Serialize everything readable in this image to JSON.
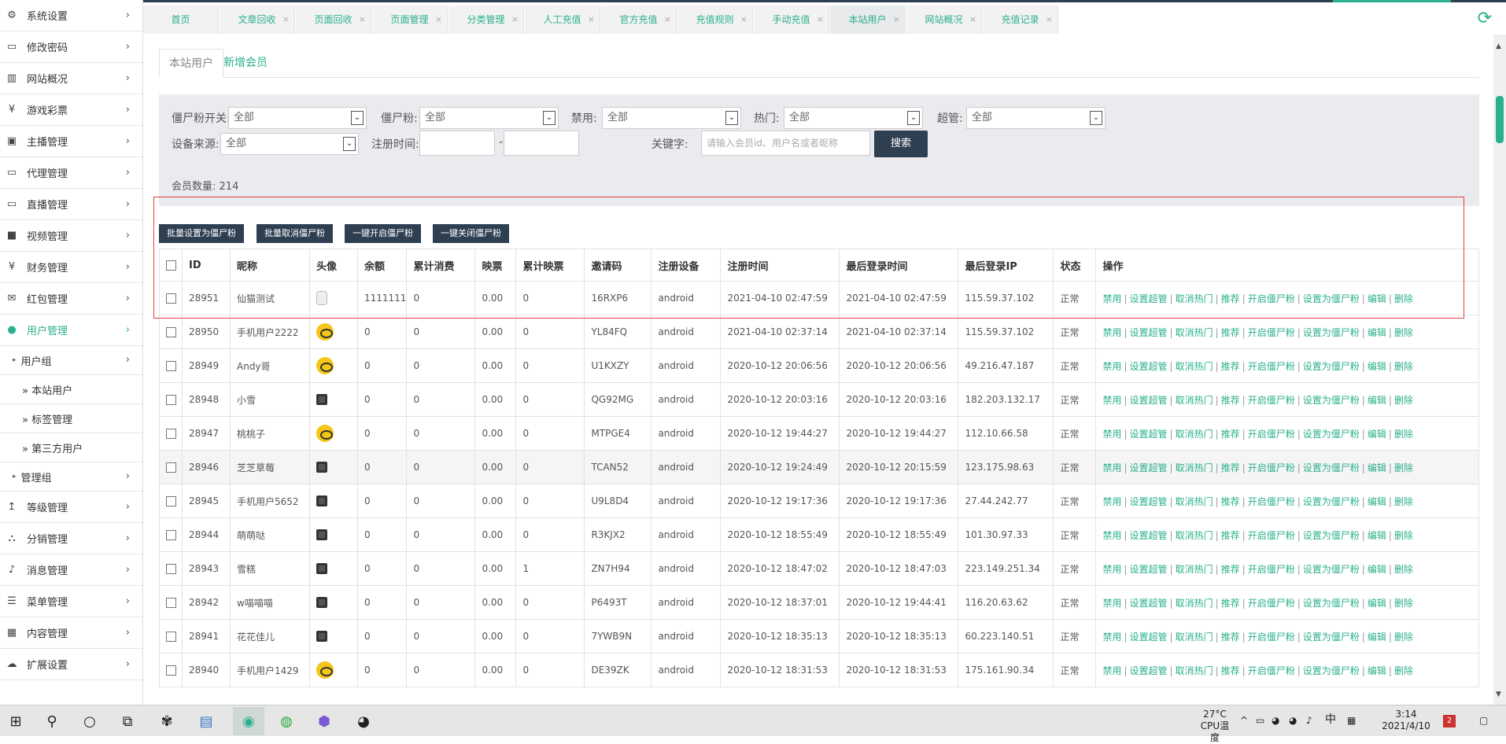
{
  "sidebar": {
    "items": [
      {
        "label": "系统设置",
        "icon": "gear-icon",
        "glyph": "⚙"
      },
      {
        "label": "修改密码",
        "icon": "monitor-icon",
        "glyph": "▭"
      },
      {
        "label": "网站概况",
        "icon": "bar-chart-icon",
        "glyph": "▥"
      },
      {
        "label": "游戏彩票",
        "icon": "yen-icon",
        "glyph": "¥"
      },
      {
        "label": "主播管理",
        "icon": "id-card-icon",
        "glyph": "▣"
      },
      {
        "label": "代理管理",
        "icon": "monitor-icon",
        "glyph": "▭"
      },
      {
        "label": "直播管理",
        "icon": "monitor-icon",
        "glyph": "▭"
      },
      {
        "label": "视频管理",
        "icon": "video-camera-icon",
        "glyph": "■"
      },
      {
        "label": "财务管理",
        "icon": "yen-icon",
        "glyph": "¥"
      },
      {
        "label": "红包管理",
        "icon": "envelope-icon",
        "glyph": "✉"
      },
      {
        "label": "用户管理",
        "icon": "users-icon",
        "glyph": "●"
      }
    ],
    "subitems": [
      {
        "label": "用户组"
      }
    ],
    "subsubitems": [
      {
        "label": "» 本站用户"
      },
      {
        "label": "» 标签管理"
      },
      {
        "label": "» 第三方用户"
      }
    ],
    "subitems2": [
      {
        "label": "管理组"
      }
    ],
    "items2": [
      {
        "label": "等级管理",
        "icon": "level-up-icon",
        "glyph": "↥"
      },
      {
        "label": "分销管理",
        "icon": "sitemap-icon",
        "glyph": "⛬"
      },
      {
        "label": "消息管理",
        "icon": "bell-icon",
        "glyph": "♪"
      },
      {
        "label": "菜单管理",
        "icon": "list-icon",
        "glyph": "☰"
      },
      {
        "label": "内容管理",
        "icon": "grid-icon",
        "glyph": "▦"
      },
      {
        "label": "扩展设置",
        "icon": "cloud-icon",
        "glyph": "☁"
      }
    ]
  },
  "tabs": [
    "首页",
    "文章回收",
    "页面回收",
    "页面管理",
    "分类管理",
    "人工充值",
    "官方充值",
    "充值规则",
    "手动充值",
    "本站用户",
    "网站概况",
    "充值记录"
  ],
  "active_tab": "本站用户",
  "subtabs": {
    "first": "本站用户",
    "second": "新增会员"
  },
  "filters": {
    "zombie_switch_label": "僵尸粉开关:",
    "zombie_label": "僵尸粉:",
    "ban_label": "禁用:",
    "hot_label": "热门:",
    "super_label": "超管:",
    "device_label": "设备来源:",
    "reg_time_label": "注册时间:",
    "keyword_label": "关键字:",
    "all": "全部",
    "dash": "-",
    "keyword_placeholder": "请输入会员id、用户名或者昵称",
    "search_button": "搜索",
    "member_count_label": "会员数量:",
    "member_count": "214"
  },
  "bulk": [
    "批量设置为僵尸粉",
    "批量取消僵尸粉",
    "一键开启僵尸粉",
    "一键关闭僵尸粉"
  ],
  "table": {
    "headers": [
      "ID",
      "昵称",
      "头像",
      "余额",
      "累计消费",
      "映票",
      "累计映票",
      "邀请码",
      "注册设备",
      "注册时间",
      "最后登录时间",
      "最后登录IP",
      "状态",
      "操作"
    ],
    "ops": [
      "禁用",
      "设置超管",
      "取消热门",
      "推荐",
      "开启僵尸粉",
      "设置为僵尸粉",
      "编辑",
      "删除"
    ],
    "rows": [
      [
        "28951",
        "仙猫测试",
        "light",
        "1111111",
        "0",
        "0.00",
        "0",
        "16RXP6",
        "android",
        "2021-04-10 02:47:59",
        "2021-04-10 02:47:59",
        "115.59.37.102",
        "正常"
      ],
      [
        "28950",
        "手机用户2222",
        "yellow",
        "0",
        "0",
        "0.00",
        "0",
        "YL84FQ",
        "android",
        "2021-04-10 02:37:14",
        "2021-04-10 02:37:14",
        "115.59.37.102",
        "正常"
      ],
      [
        "28949",
        "Andy哥",
        "yellow",
        "0",
        "0",
        "0.00",
        "0",
        "U1KXZY",
        "android",
        "2020-10-12 20:06:56",
        "2020-10-12 20:06:56",
        "49.216.47.187",
        "正常"
      ],
      [
        "28948",
        "小雪",
        "dark",
        "0",
        "0",
        "0.00",
        "0",
        "QG92MG",
        "android",
        "2020-10-12 20:03:16",
        "2020-10-12 20:03:16",
        "182.203.132.17",
        "正常"
      ],
      [
        "28947",
        "桃桃子",
        "yellow",
        "0",
        "0",
        "0.00",
        "0",
        "MTPGE4",
        "android",
        "2020-10-12 19:44:27",
        "2020-10-12 19:44:27",
        "112.10.66.58",
        "正常"
      ],
      [
        "28946",
        "芝芝草莓",
        "dark",
        "0",
        "0",
        "0.00",
        "0",
        "TCAN52",
        "android",
        "2020-10-12 19:24:49",
        "2020-10-12 20:15:59",
        "123.175.98.63",
        "正常"
      ],
      [
        "28945",
        "手机用户5652",
        "dark",
        "0",
        "0",
        "0.00",
        "0",
        "U9L8D4",
        "android",
        "2020-10-12 19:17:36",
        "2020-10-12 19:17:36",
        "27.44.242.77",
        "正常"
      ],
      [
        "28944",
        "萌萌哒",
        "dark",
        "0",
        "0",
        "0.00",
        "0",
        "R3KJX2",
        "android",
        "2020-10-12 18:55:49",
        "2020-10-12 18:55:49",
        "101.30.97.33",
        "正常"
      ],
      [
        "28943",
        "雪糕",
        "dark",
        "0",
        "0",
        "0.00",
        "1",
        "ZN7H94",
        "android",
        "2020-10-12 18:47:02",
        "2020-10-12 18:47:03",
        "223.149.251.34",
        "正常"
      ],
      [
        "28942",
        "w喵喵喵",
        "dark",
        "0",
        "0",
        "0.00",
        "0",
        "P6493T",
        "android",
        "2020-10-12 18:37:01",
        "2020-10-12 19:44:41",
        "116.20.63.62",
        "正常"
      ],
      [
        "28941",
        "花花佳儿",
        "dark",
        "0",
        "0",
        "0.00",
        "0",
        "7YWB9N",
        "android",
        "2020-10-12 18:35:13",
        "2020-10-12 18:35:13",
        "60.223.140.51",
        "正常"
      ],
      [
        "28940",
        "手机用户1429",
        "yellow",
        "0",
        "0",
        "0.00",
        "0",
        "DE39ZK",
        "android",
        "2020-10-12 18:31:53",
        "2020-10-12 18:31:53",
        "175.161.90.34",
        "正常"
      ]
    ]
  },
  "taskbar": {
    "temp": "27°C",
    "cpu": "CPU温度",
    "ime": "中",
    "time": "3:14",
    "date": "2021/4/10",
    "notif": "2"
  }
}
